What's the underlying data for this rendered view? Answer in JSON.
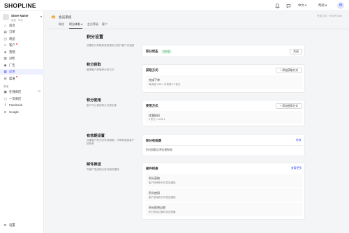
{
  "brand": {
    "logo_text": "SHOPLINE"
  },
  "topbar": {
    "bell_icon": "bell-icon",
    "chat_icon": "chat-icon",
    "language": "中文",
    "help": "帮助",
    "avatar_initial": "H"
  },
  "store": {
    "name": "Store Name",
    "subtitle": "免费 · 30天"
  },
  "sidebar": {
    "items": [
      {
        "name": "home",
        "label": "首页",
        "icon": "⌂"
      },
      {
        "name": "orders",
        "label": "订单",
        "icon": "▤"
      },
      {
        "name": "products",
        "label": "商品",
        "icon": "◫"
      },
      {
        "name": "customers",
        "label": "客户",
        "icon": "☺",
        "dot": true
      },
      {
        "name": "marketing",
        "label": "营销",
        "icon": "◈"
      },
      {
        "name": "analytics",
        "label": "分析",
        "icon": "▥"
      },
      {
        "name": "ads",
        "label": "广告",
        "icon": "◉"
      },
      {
        "name": "apps",
        "label": "应用",
        "icon": "▦",
        "active": true
      },
      {
        "name": "channels",
        "label": "渠道",
        "icon": "☰",
        "dot": true
      }
    ],
    "channels_label": "渠道",
    "channels": [
      {
        "name": "online-store",
        "label": "在线商店",
        "icon": "▣",
        "count": "10"
      },
      {
        "name": "pos",
        "label": "一页商店",
        "icon": "▢"
      },
      {
        "name": "facebook",
        "label": "Facebook",
        "icon": "f"
      },
      {
        "name": "google",
        "label": "Google",
        "icon": "G"
      }
    ],
    "settings_label": "设置"
  },
  "app": {
    "icon": "crown-icon",
    "title": "会员系统",
    "breadcrumb": "开发人员 · SHOPLINE"
  },
  "tabs": [
    "概览",
    "积分体系",
    "会员等级",
    "客户"
  ],
  "page": {
    "title": "积分设置",
    "intro": "设置积分获取和使用规则以提升客户忠诚度"
  },
  "sections": {
    "status": {
      "card_title": "积分状态",
      "badge": "已开启",
      "button": "关闭"
    },
    "earn": {
      "title": "积分获取",
      "desc": "管理客户获取积分的方式",
      "card_title": "获取方式",
      "button": "+ 添加获取方式",
      "item_title": "完成下单",
      "item_desc": "每消费 US$ 1 可获得 10 积分"
    },
    "redeem": {
      "title": "积分使用",
      "desc": "客户可以使用积分兑换优惠",
      "card_title": "使用方式",
      "button": "+ 添加使用方式",
      "item_title": "优惠抵扣",
      "item_desc": "1 积分 = US$ 1"
    },
    "expiry": {
      "title": "有效期设置",
      "desc": "设置客户积分的有效期限，可帮助提高客户回购率",
      "card_title": "积分有效期",
      "link": "修改",
      "text": "积分获取后将长期有效"
    },
    "email": {
      "title": "邮件推送",
      "desc": "向客户发送积分变动相关通知",
      "card_title": "邮件列表",
      "link": "查看更多",
      "items": [
        {
          "title": "积分获取",
          "desc": "客户获得积分时发送通知"
        },
        {
          "title": "积分使用",
          "desc": "客户使用积分时发送通知"
        },
        {
          "title": "积分即将过期",
          "desc": "积分即将过期时发送提醒"
        }
      ]
    }
  }
}
